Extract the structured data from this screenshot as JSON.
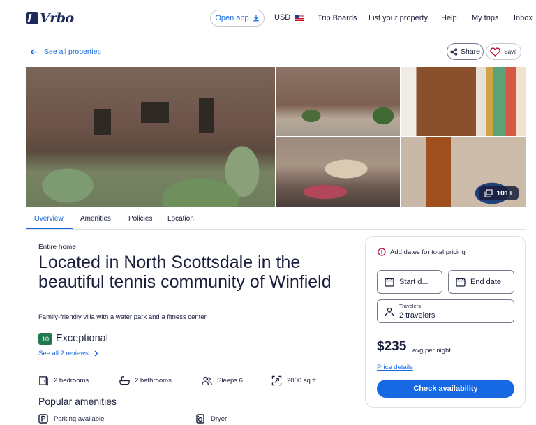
{
  "header": {
    "logo_text": "Vrbo",
    "open_app_label": "Open app",
    "currency_label": "USD",
    "nav": [
      "Trip Boards",
      "List your property",
      "Help",
      "My trips",
      "Inbox"
    ]
  },
  "topbar": {
    "back_label": "See all properties",
    "share_label": "Share",
    "save_label": "Save"
  },
  "gallery": {
    "photo_count_label": "101+"
  },
  "tabs": [
    {
      "label": "Overview",
      "active": true
    },
    {
      "label": "Amenities",
      "active": false
    },
    {
      "label": "Policies",
      "active": false
    },
    {
      "label": "Location",
      "active": false
    }
  ],
  "listing": {
    "type": "Entire home",
    "title": "Located in North Scottsdale in the beautiful tennis community of Winfield",
    "subtitle": "Family-friendly villa with a water park and a fitness center",
    "rating_score": "10",
    "rating_label": "Exceptional",
    "reviews_link": "See all 2 reviews",
    "facts": {
      "bedrooms": "2 bedrooms",
      "bathrooms": "2 bathrooms",
      "sleeps": "Sleeps 6",
      "area": "2000 sq ft"
    },
    "amenities_heading": "Popular amenities",
    "amenities": [
      "Parking available",
      "Dryer"
    ]
  },
  "booking": {
    "alert_text": "Add dates for total pricing",
    "start_date_placeholder": "Start d...",
    "end_date_placeholder": "End date",
    "travelers_label": "Travelers",
    "travelers_value": "2 travelers",
    "price": "$235",
    "price_note": "avg per night",
    "price_details_link": "Price details",
    "cta_label": "Check availability"
  },
  "colors": {
    "brand_blue": "#1668e3",
    "navy": "#191e3b",
    "rating_green": "#227950"
  }
}
